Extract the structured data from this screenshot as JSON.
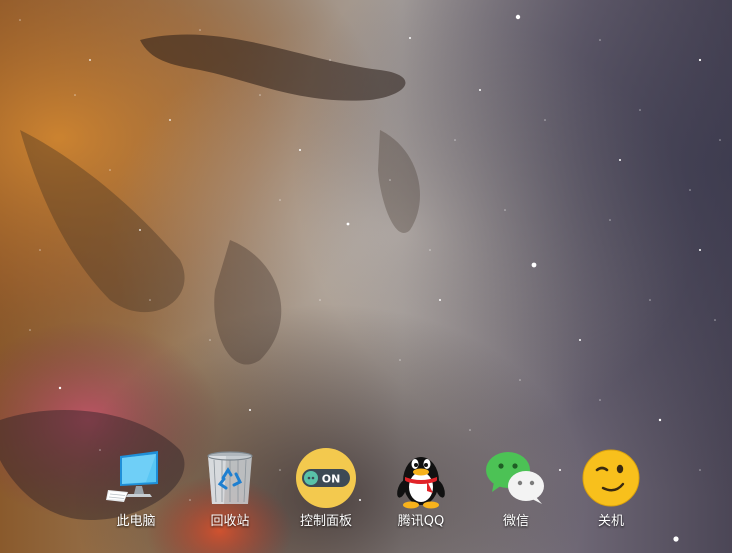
{
  "desktop": {
    "wallpaper": "nebula-starfield",
    "dock": [
      {
        "label": "此电脑",
        "icon": "computer-monitor-icon"
      },
      {
        "label": "回收站",
        "icon": "recycle-bin-icon"
      },
      {
        "label": "控制面板",
        "icon": "toggle-switch-icon",
        "icon_text": "ON"
      },
      {
        "label": "腾讯QQ",
        "icon": "qq-penguin-icon"
      },
      {
        "label": "微信",
        "icon": "wechat-icon"
      },
      {
        "label": "关机",
        "icon": "wink-face-icon"
      }
    ]
  },
  "colors": {
    "toggle_bg": "#f3c94e",
    "toggle_track": "#3d4a55",
    "toggle_knob": "#59c1a8",
    "wechat_green": "#4cc255",
    "face_yellow": "#f8c01c"
  }
}
